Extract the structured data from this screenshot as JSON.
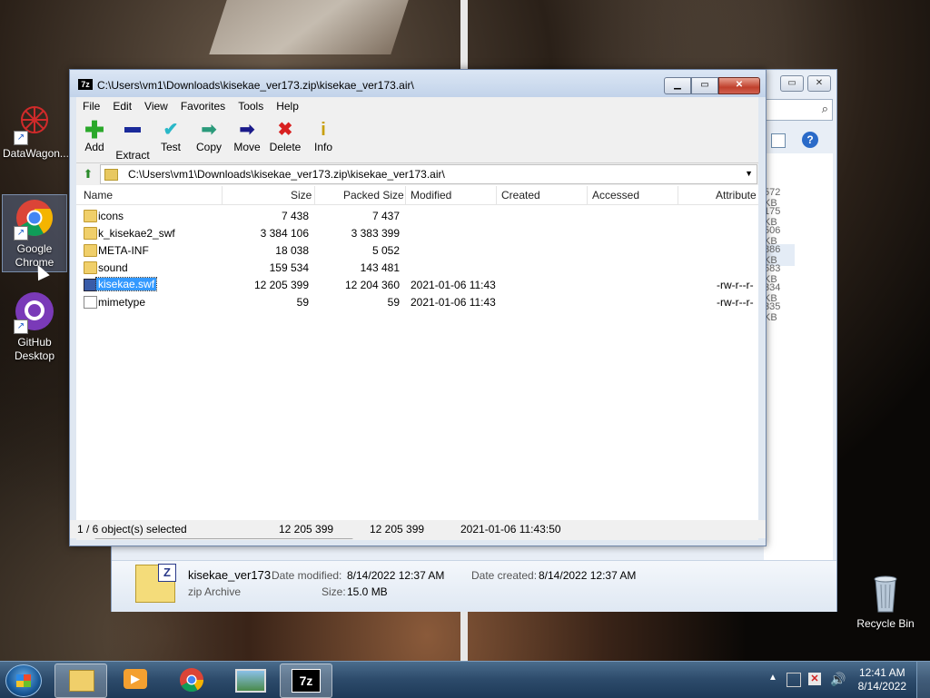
{
  "desktop": {
    "icons": [
      {
        "label": "DataWagon..."
      },
      {
        "label": "Google Chrome"
      },
      {
        "label": "GitHub Desktop"
      },
      {
        "label": "Recycle Bin"
      }
    ]
  },
  "bg_explorer": {
    "sizes": [
      "572 KB",
      "175 KB",
      "506 KB",
      "886 KB",
      "583 KB",
      "334 KB",
      "335 KB"
    ],
    "details": {
      "name": "kisekae_ver173",
      "type": "zip Archive",
      "modified_label": "Date modified:",
      "modified": "8/14/2022 12:37 AM",
      "created_label": "Date created:",
      "created": "8/14/2022 12:37 AM",
      "size_label": "Size:",
      "size": "15.0 MB"
    }
  },
  "sevenzip": {
    "title": "C:\\Users\\vm1\\Downloads\\kisekae_ver173.zip\\kisekae_ver173.air\\",
    "menu": [
      "File",
      "Edit",
      "View",
      "Favorites",
      "Tools",
      "Help"
    ],
    "toolbar": [
      {
        "label": "Add",
        "icon": "plus-icon",
        "color": "#2aa82a"
      },
      {
        "label": "Extract",
        "icon": "minus-icon",
        "color": "#1a2a9a"
      },
      {
        "label": "Test",
        "icon": "check-icon",
        "color": "#2ab8c8"
      },
      {
        "label": "Copy",
        "icon": "copy-arrow-icon",
        "color": "#2a9a7a"
      },
      {
        "label": "Move",
        "icon": "move-arrow-icon",
        "color": "#1a1a8a"
      },
      {
        "label": "Delete",
        "icon": "delete-x-icon",
        "color": "#d82020"
      },
      {
        "label": "Info",
        "icon": "info-icon",
        "color": "#d8b020"
      }
    ],
    "address": "C:\\Users\\vm1\\Downloads\\kisekae_ver173.zip\\kisekae_ver173.air\\",
    "columns": [
      "Name",
      "Size",
      "Packed Size",
      "Modified",
      "Created",
      "Accessed",
      "Attribute"
    ],
    "rows": [
      {
        "name": "icons",
        "type": "folder",
        "size": "7 438",
        "packed": "7 437",
        "modified": "",
        "attr": ""
      },
      {
        "name": "k_kisekae2_swf",
        "type": "folder",
        "size": "3 384 106",
        "packed": "3 383 399",
        "modified": "",
        "attr": ""
      },
      {
        "name": "META-INF",
        "type": "folder",
        "size": "18 038",
        "packed": "5 052",
        "modified": "",
        "attr": ""
      },
      {
        "name": "sound",
        "type": "folder",
        "size": "159 534",
        "packed": "143 481",
        "modified": "",
        "attr": ""
      },
      {
        "name": "kisekae.swf",
        "type": "swf",
        "size": "12 205 399",
        "packed": "12 204 360",
        "modified": "2021-01-06 11:43",
        "attr": "-rw-r--r-"
      },
      {
        "name": "mimetype",
        "type": "file",
        "size": "59",
        "packed": "59",
        "modified": "2021-01-06 11:43",
        "attr": "-rw-r--r-"
      }
    ],
    "status": {
      "selection": "1 / 6 object(s) selected",
      "size": "12 205 399",
      "packed": "12 205 399",
      "modified": "2021-01-06 11:43:50"
    }
  },
  "taskbar": {
    "time": "12:41 AM",
    "date": "8/14/2022"
  }
}
